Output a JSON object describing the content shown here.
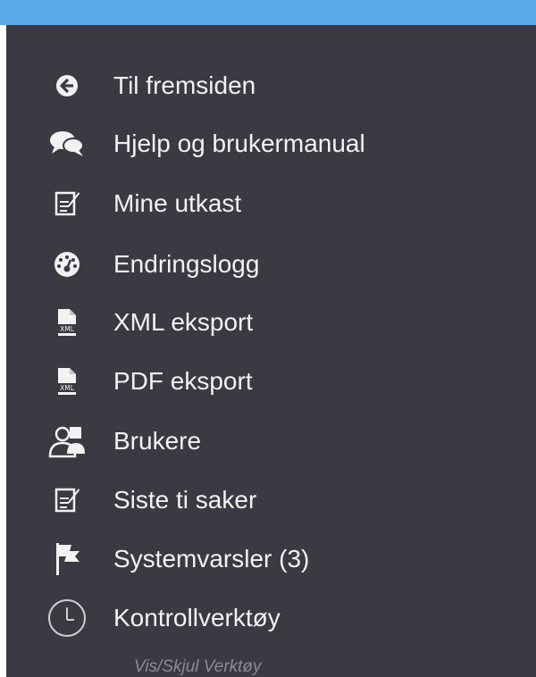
{
  "colors": {
    "top_bar": "#5aa8e6",
    "panel_background": "#3b3a43",
    "text": "#f2f2f2",
    "muted_text": "#8c8b93"
  },
  "menu": {
    "items": [
      {
        "label": "Til fremsiden",
        "icon": "arrow-left-circle-icon"
      },
      {
        "label": "Hjelp og brukermanual",
        "icon": "chat-bubbles-icon"
      },
      {
        "label": "Mine utkast",
        "icon": "edit-document-icon"
      },
      {
        "label": "Endringslogg",
        "icon": "dashboard-gauge-icon"
      },
      {
        "label": "XML eksport",
        "icon": "xml-file-icon"
      },
      {
        "label": "PDF eksport",
        "icon": "pdf-file-icon"
      },
      {
        "label": "Brukere",
        "icon": "users-icon"
      },
      {
        "label": "Siste ti saker",
        "icon": "edit-document-icon"
      },
      {
        "label": "Systemvarsler (3)",
        "icon": "flag-icon"
      },
      {
        "label": "Kontrollverktøy",
        "icon": "clock-icon"
      }
    ]
  },
  "footer": {
    "toggle_label": "Vis/Skjul Verktøy"
  }
}
